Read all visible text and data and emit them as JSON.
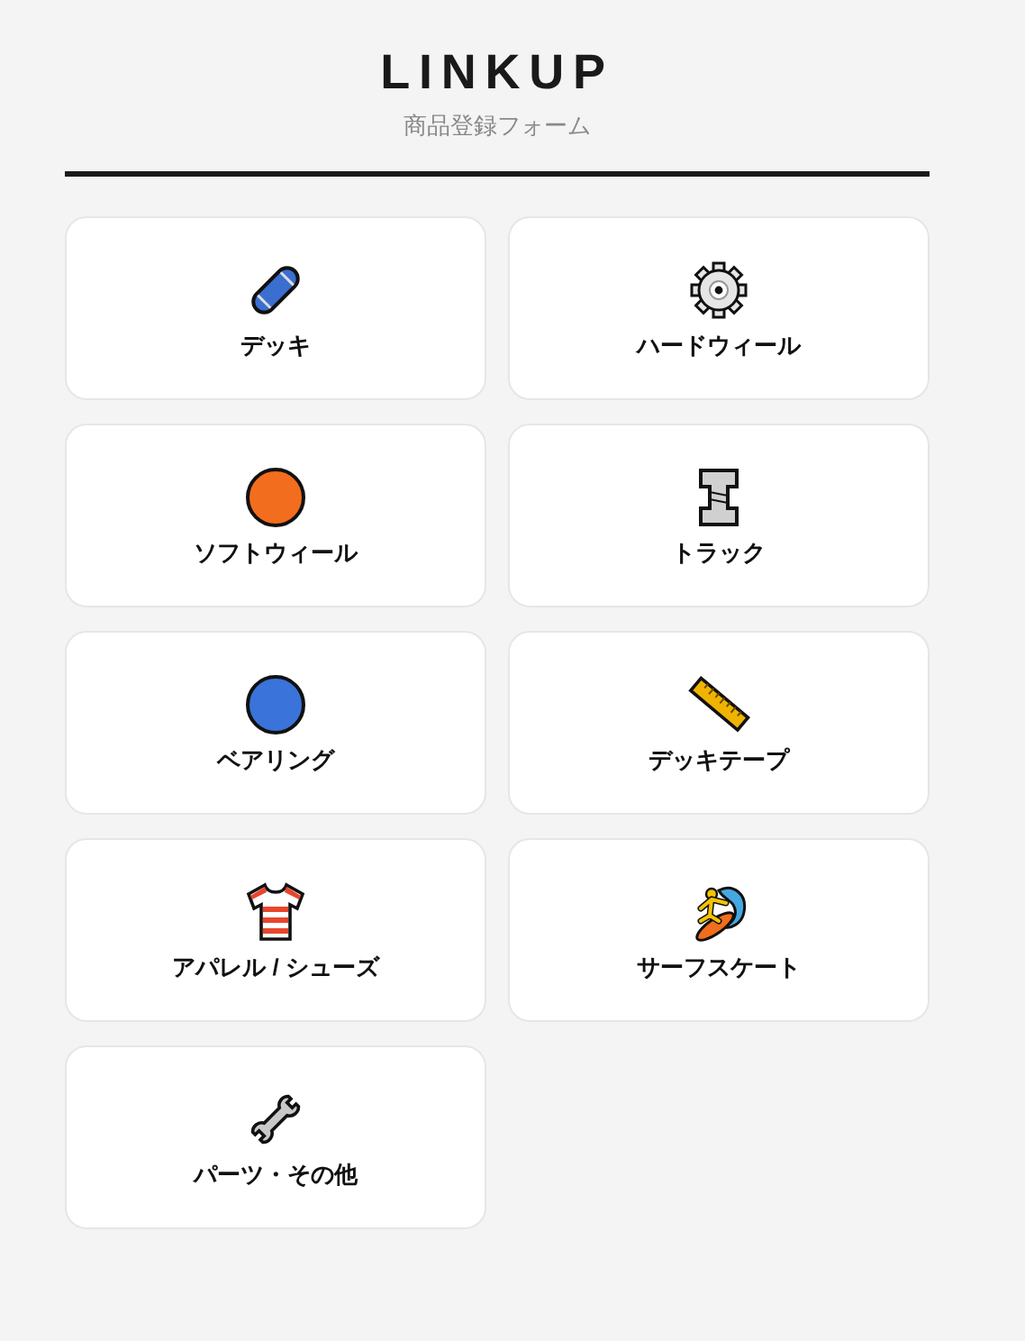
{
  "header": {
    "title": "LINKUP",
    "subtitle": "商品登録フォーム"
  },
  "categories": [
    {
      "label": "デッキ",
      "kind": "skateboard"
    },
    {
      "label": "ハードウィール",
      "kind": "gear"
    },
    {
      "label": "ソフトウィール",
      "kind": "orange-circle"
    },
    {
      "label": "トラック",
      "kind": "bolt"
    },
    {
      "label": "ベアリング",
      "kind": "blue-circle"
    },
    {
      "label": "デッキテープ",
      "kind": "ruler"
    },
    {
      "label": "アパレル / シューズ",
      "kind": "shirt"
    },
    {
      "label": "サーフスケート",
      "kind": "surfer"
    },
    {
      "label": "パーツ・その他",
      "kind": "wrench"
    }
  ]
}
